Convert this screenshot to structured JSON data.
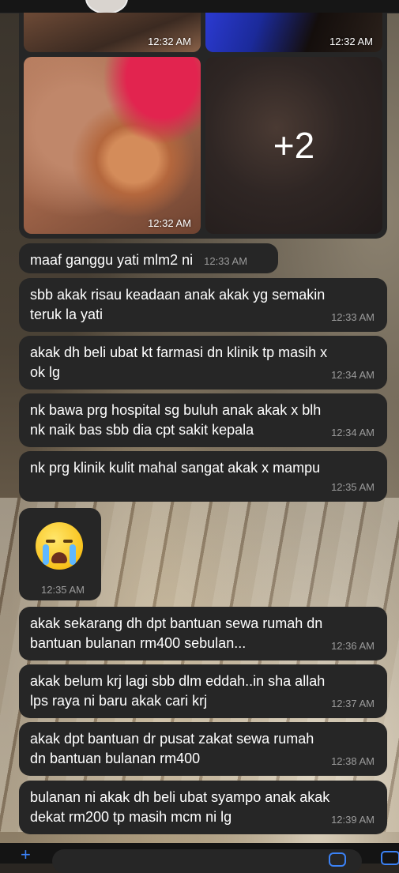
{
  "media": {
    "photos": [
      {
        "time": "12:32 AM"
      },
      {
        "time": "12:32 AM"
      },
      {
        "time": "12:32 AM"
      },
      {
        "more_count": "+2"
      }
    ]
  },
  "messages": [
    {
      "text": "maaf ganggu yati mlm2 ni",
      "time": "12:33 AM"
    },
    {
      "text": "sbb akak risau keadaan anak akak yg semakin\nteruk la yati",
      "time": "12:33 AM"
    },
    {
      "text": "akak dh beli ubat kt farmasi dn klinik tp masih x\nok lg",
      "time": "12:34 AM"
    },
    {
      "text": "nk bawa prg hospital sg buluh anak akak x blh\nnk naik bas sbb dia cpt sakit kepala",
      "time": "12:34 AM"
    },
    {
      "text": "nk prg klinik kulit mahal sangat akak x mampu",
      "time": "12:35 AM"
    },
    {
      "text": "akak sekarang dh dpt bantuan sewa rumah dn\nbantuan bulanan rm400 sebulan...",
      "time": "12:36 AM"
    },
    {
      "text": "akak belum krj lagi sbb dlm eddah..in sha allah\nlps raya ni baru akak cari krj",
      "time": "12:37 AM"
    },
    {
      "text": "akak dpt bantuan dr pusat zakat sewa rumah\ndn bantuan bulanan rm400",
      "time": "12:38 AM"
    },
    {
      "text": "bulanan ni akak dh beli ubat syampo anak akak\ndekat rm200 tp masih mcm ni lg",
      "time": "12:39 AM"
    }
  ],
  "sticker": {
    "emoji": "loudly-crying-face",
    "time": "12:35 AM"
  },
  "composer": {
    "plus_icon": "plus-icon",
    "sticker_icon": "sticker-icon",
    "camera_icon": "camera-icon"
  },
  "colors": {
    "bubble": "#262626",
    "accent": "#3b82f6",
    "timestamp": "#9b9b9b"
  }
}
